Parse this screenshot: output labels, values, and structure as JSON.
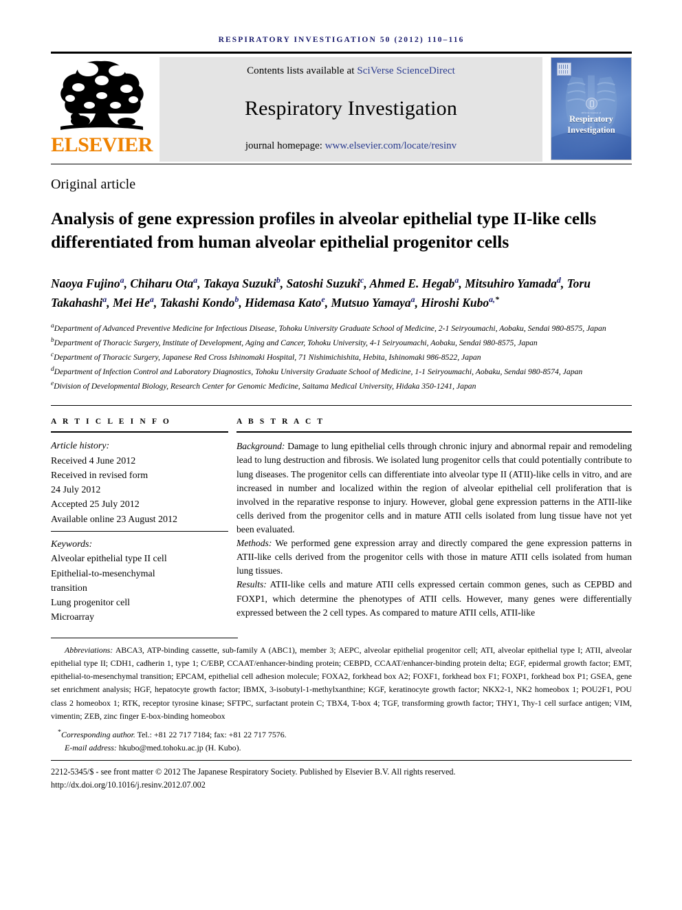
{
  "running_head": "RESPIRATORY INVESTIGATION 50 (2012) 110–116",
  "masthead": {
    "publisher_name": "ELSEVIER",
    "contents_prefix": "Contents lists available at ",
    "contents_link": "SciVerse ScienceDirect",
    "journal_name": "Respiratory Investigation",
    "homepage_prefix": "journal homepage: ",
    "homepage_link": "www.elsevier.com/locate/resinv",
    "cover_title_line1": "Respiratory",
    "cover_title_line2": "Investigation",
    "cover_society_line1": "Official Journal of",
    "cover_society_line2": "The Japanese Respiratory Society",
    "link_color": "#2b3c8f",
    "elsevier_orange": "#ef8200",
    "band_gray": "#e4e4e4"
  },
  "article": {
    "type": "Original article",
    "title": "Analysis of gene expression profiles in alveolar epithelial type II-like cells differentiated from human alveolar epithelial progenitor cells"
  },
  "authors": [
    {
      "name": "Naoya Fujino",
      "sup": "a",
      "sep": ", "
    },
    {
      "name": "Chiharu Ota",
      "sup": "a",
      "sep": ", "
    },
    {
      "name": "Takaya Suzuki",
      "sup": "b",
      "sep": ", "
    },
    {
      "name": "Satoshi Suzuki",
      "sup": "c",
      "sep": ", "
    },
    {
      "name": "Ahmed E. Hegab",
      "sup": "a",
      "sep": ", "
    },
    {
      "name": "Mitsuhiro Yamada",
      "sup": "d",
      "sep": ", "
    },
    {
      "name": "Toru Takahashi",
      "sup": "a",
      "sep": ", "
    },
    {
      "name": "Mei He",
      "sup": "a",
      "sep": ", "
    },
    {
      "name": "Takashi Kondo",
      "sup": "b",
      "sep": ", "
    },
    {
      "name": "Hidemasa Kato",
      "sup": "e",
      "sep": ", "
    },
    {
      "name": "Mutsuo Yamaya",
      "sup": "a",
      "sep": ", "
    },
    {
      "name": "Hiroshi Kubo",
      "sup": "a,",
      "star": "*",
      "sep": ""
    }
  ],
  "affiliations": [
    {
      "marker": "a",
      "text": "Department of Advanced Preventive Medicine for Infectious Disease, Tohoku University Graduate School of Medicine, 2-1 Seiryoumachi, Aobaku, Sendai 980-8575, Japan"
    },
    {
      "marker": "b",
      "text": "Department of Thoracic Surgery, Institute of Development, Aging and Cancer, Tohoku University, 4-1 Seiryoumachi, Aobaku, Sendai 980-8575, Japan"
    },
    {
      "marker": "c",
      "text": "Department of Thoracic Surgery, Japanese Red Cross Ishinomaki Hospital, 71 Nishimichishita, Hebita, Ishinomaki 986-8522, Japan"
    },
    {
      "marker": "d",
      "text": "Department of Infection Control and Laboratory Diagnostics, Tohoku University Graduate School of Medicine, 1-1 Seiryoumachi, Aobaku, Sendai 980-8574, Japan"
    },
    {
      "marker": "e",
      "text": "Division of Developmental Biology, Research Center for Genomic Medicine, Saitama Medical University, Hidaka 350-1241, Japan"
    }
  ],
  "article_info": {
    "heading": "A R T I C L E   I N F O",
    "history_label": "Article history:",
    "history": [
      "Received 4 June 2012",
      "Received in revised form",
      "24 July 2012",
      "Accepted 25 July 2012",
      "Available online 23 August 2012"
    ],
    "keywords_label": "Keywords:",
    "keywords": [
      "Alveolar epithelial type II cell",
      "Epithelial-to-mesenchymal",
      "transition",
      "Lung progenitor cell",
      "Microarray"
    ]
  },
  "abstract": {
    "heading": "A B S T R A C T",
    "sections": [
      {
        "label": "Background:",
        "text": " Damage to lung epithelial cells through chronic injury and abnormal repair and remodeling lead to lung destruction and fibrosis. We isolated lung progenitor cells that could potentially contribute to lung diseases. The progenitor cells can differentiate into alveolar type II (ATII)-like cells in vitro, and are increased in number and localized within the region of alveolar epithelial cell proliferation that is involved in the reparative response to injury. However, global gene expression patterns in the ATII-like cells derived from the progenitor cells and in mature ATII cells isolated from lung tissue have not yet been evaluated."
      },
      {
        "label": "Methods:",
        "text": " We performed gene expression array and directly compared the gene expression patterns in ATII-like cells derived from the progenitor cells with those in mature ATII cells isolated from human lung tissues."
      },
      {
        "label": "Results:",
        "text": " ATII-like cells and mature ATII cells expressed certain common genes, such as CEPBD and FOXP1, which determine the phenotypes of ATII cells. However, many genes were differentially expressed between the 2 cell types. As compared to mature ATII cells, ATII-like"
      }
    ]
  },
  "footnotes": {
    "abbreviations_label": "Abbreviations:",
    "abbreviations_text": " ABCA3,   ATP-binding cassette, sub-family A (ABC1), member 3; AEPC,   alveolar epithelial progenitor cell; ATI,   alveolar epithelial type I; ATII,   alveolar epithelial type II; CDH1,   cadherin 1, type 1; C/EBP,   CCAAT/enhancer-binding protein; CEBPD,   CCAAT/enhancer-binding protein delta; EGF,   epidermal growth factor; EMT,   epithelial-to-mesenchymal transition; EPCAM,   epithelial cell adhesion molecule; FOXA2,   forkhead box A2; FOXF1,   forkhead box F1; FOXP1,   forkhead box P1; GSEA,   gene set enrichment analysis; HGF,   hepatocyte growth factor; IBMX,   3-isobutyl-1-methylxanthine; KGF,   keratinocyte growth factor; NKX2-1,   NK2 homeobox 1; POU2F1,   POU class 2 homeobox 1; RTK,   receptor tyrosine kinase; SFTPC,   surfactant protein C; TBX4, T-box 4; TGF,   transforming growth factor; THY1,   Thy-1 cell surface antigen; VIM,   vimentin; ZEB,   zinc finger E-box-binding homeobox",
    "corresponding_marker": "*",
    "corresponding_label": "Corresponding author.",
    "corresponding_text": " Tel.: +81 22 717 7184; fax: +81 22 717 7576.",
    "email_label": "E-mail address:",
    "email_value": " hkubo@med.tohoku.ac.jp (H. Kubo).",
    "copyright": "2212-5345/$ - see front matter © 2012 The Japanese Respiratory Society. Published by Elsevier B.V. All rights reserved.",
    "doi": "http://dx.doi.org/10.1016/j.resinv.2012.07.002"
  }
}
